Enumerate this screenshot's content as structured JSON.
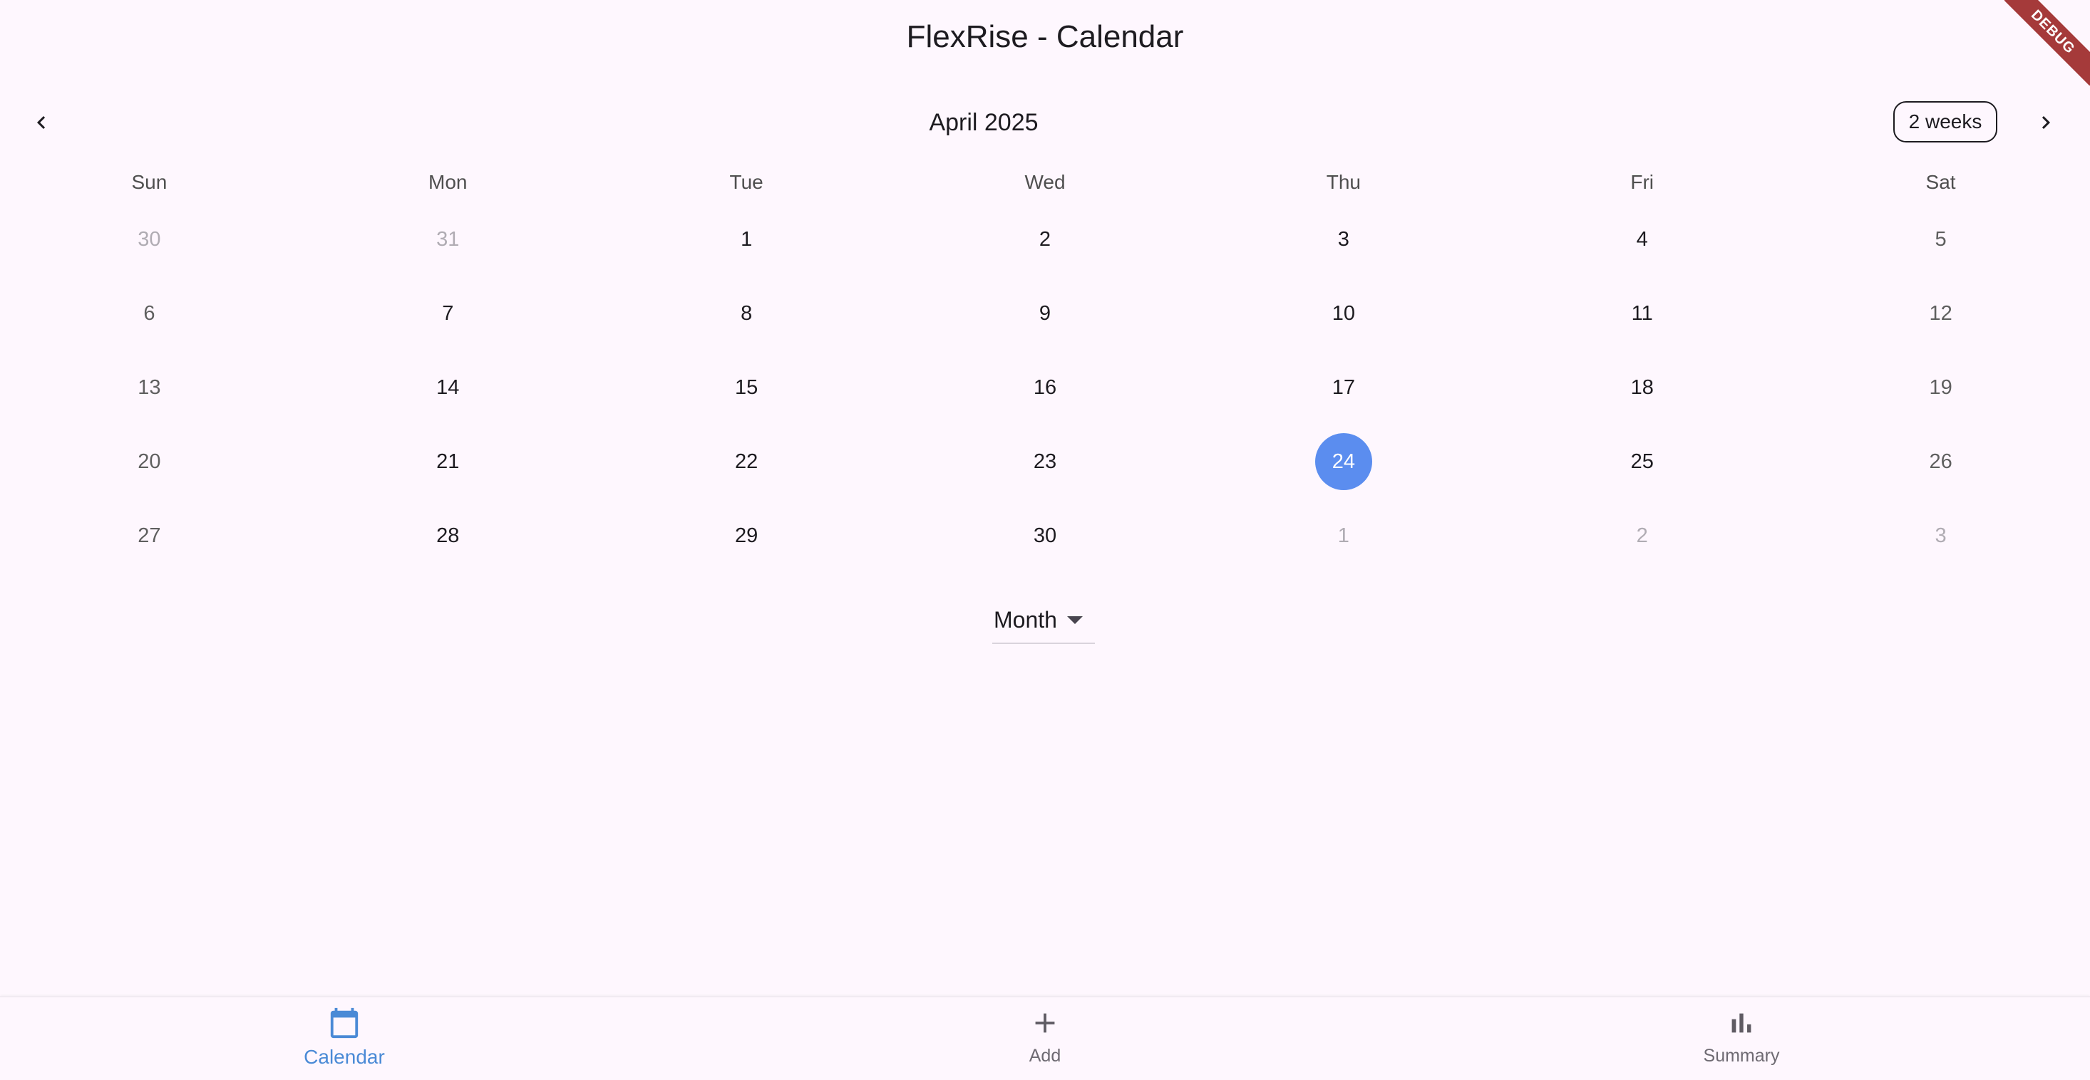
{
  "app": {
    "title": "FlexRise - Calendar",
    "debug_banner": "DEBUG"
  },
  "calendar": {
    "month_title": "April 2025",
    "format_button": "2 weeks",
    "prev_icon": "chevron-left-icon",
    "next_icon": "chevron-right-icon",
    "weekdays": [
      "Sun",
      "Mon",
      "Tue",
      "Wed",
      "Thu",
      "Fri",
      "Sat"
    ],
    "weeks": [
      [
        {
          "day": "30",
          "outside": true
        },
        {
          "day": "31",
          "outside": true
        },
        {
          "day": "1"
        },
        {
          "day": "2"
        },
        {
          "day": "3"
        },
        {
          "day": "4"
        },
        {
          "day": "5",
          "weekend": true
        }
      ],
      [
        {
          "day": "6",
          "weekend": true
        },
        {
          "day": "7"
        },
        {
          "day": "8"
        },
        {
          "day": "9"
        },
        {
          "day": "10"
        },
        {
          "day": "11"
        },
        {
          "day": "12",
          "weekend": true
        }
      ],
      [
        {
          "day": "13",
          "weekend": true
        },
        {
          "day": "14"
        },
        {
          "day": "15"
        },
        {
          "day": "16"
        },
        {
          "day": "17"
        },
        {
          "day": "18"
        },
        {
          "day": "19",
          "weekend": true
        }
      ],
      [
        {
          "day": "20",
          "weekend": true
        },
        {
          "day": "21"
        },
        {
          "day": "22"
        },
        {
          "day": "23"
        },
        {
          "day": "24",
          "selected": true
        },
        {
          "day": "25"
        },
        {
          "day": "26",
          "weekend": true
        }
      ],
      [
        {
          "day": "27",
          "weekend": true
        },
        {
          "day": "28"
        },
        {
          "day": "29"
        },
        {
          "day": "30"
        },
        {
          "day": "1",
          "outside": true
        },
        {
          "day": "2",
          "outside": true
        },
        {
          "day": "3",
          "outside": true
        }
      ]
    ],
    "selected_color": "#5b8def"
  },
  "view_selector": {
    "value": "Month",
    "icon": "arrow-drop-down-icon"
  },
  "bottom_nav": {
    "items": [
      {
        "label": "Calendar",
        "icon": "calendar-icon",
        "active": true
      },
      {
        "label": "Add",
        "icon": "plus-icon",
        "active": false
      },
      {
        "label": "Summary",
        "icon": "bar-chart-icon",
        "active": false
      }
    ],
    "active_color": "#4a8ad6"
  }
}
